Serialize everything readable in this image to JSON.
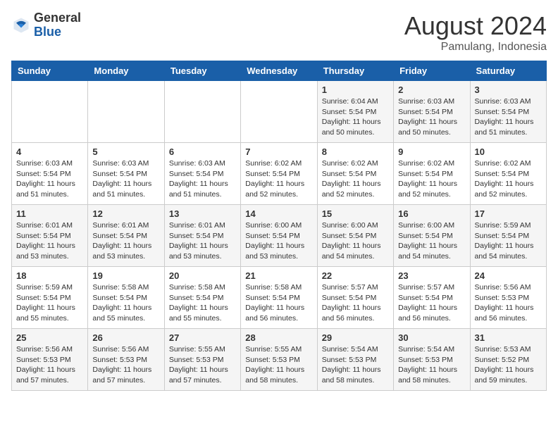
{
  "header": {
    "logo_general": "General",
    "logo_blue": "Blue",
    "month_year": "August 2024",
    "location": "Pamulang, Indonesia"
  },
  "weekdays": [
    "Sunday",
    "Monday",
    "Tuesday",
    "Wednesday",
    "Thursday",
    "Friday",
    "Saturday"
  ],
  "weeks": [
    [
      {
        "day": "",
        "info": ""
      },
      {
        "day": "",
        "info": ""
      },
      {
        "day": "",
        "info": ""
      },
      {
        "day": "",
        "info": ""
      },
      {
        "day": "1",
        "info": "Sunrise: 6:04 AM\nSunset: 5:54 PM\nDaylight: 11 hours\nand 50 minutes."
      },
      {
        "day": "2",
        "info": "Sunrise: 6:03 AM\nSunset: 5:54 PM\nDaylight: 11 hours\nand 50 minutes."
      },
      {
        "day": "3",
        "info": "Sunrise: 6:03 AM\nSunset: 5:54 PM\nDaylight: 11 hours\nand 51 minutes."
      }
    ],
    [
      {
        "day": "4",
        "info": "Sunrise: 6:03 AM\nSunset: 5:54 PM\nDaylight: 11 hours\nand 51 minutes."
      },
      {
        "day": "5",
        "info": "Sunrise: 6:03 AM\nSunset: 5:54 PM\nDaylight: 11 hours\nand 51 minutes."
      },
      {
        "day": "6",
        "info": "Sunrise: 6:03 AM\nSunset: 5:54 PM\nDaylight: 11 hours\nand 51 minutes."
      },
      {
        "day": "7",
        "info": "Sunrise: 6:02 AM\nSunset: 5:54 PM\nDaylight: 11 hours\nand 52 minutes."
      },
      {
        "day": "8",
        "info": "Sunrise: 6:02 AM\nSunset: 5:54 PM\nDaylight: 11 hours\nand 52 minutes."
      },
      {
        "day": "9",
        "info": "Sunrise: 6:02 AM\nSunset: 5:54 PM\nDaylight: 11 hours\nand 52 minutes."
      },
      {
        "day": "10",
        "info": "Sunrise: 6:02 AM\nSunset: 5:54 PM\nDaylight: 11 hours\nand 52 minutes."
      }
    ],
    [
      {
        "day": "11",
        "info": "Sunrise: 6:01 AM\nSunset: 5:54 PM\nDaylight: 11 hours\nand 53 minutes."
      },
      {
        "day": "12",
        "info": "Sunrise: 6:01 AM\nSunset: 5:54 PM\nDaylight: 11 hours\nand 53 minutes."
      },
      {
        "day": "13",
        "info": "Sunrise: 6:01 AM\nSunset: 5:54 PM\nDaylight: 11 hours\nand 53 minutes."
      },
      {
        "day": "14",
        "info": "Sunrise: 6:00 AM\nSunset: 5:54 PM\nDaylight: 11 hours\nand 53 minutes."
      },
      {
        "day": "15",
        "info": "Sunrise: 6:00 AM\nSunset: 5:54 PM\nDaylight: 11 hours\nand 54 minutes."
      },
      {
        "day": "16",
        "info": "Sunrise: 6:00 AM\nSunset: 5:54 PM\nDaylight: 11 hours\nand 54 minutes."
      },
      {
        "day": "17",
        "info": "Sunrise: 5:59 AM\nSunset: 5:54 PM\nDaylight: 11 hours\nand 54 minutes."
      }
    ],
    [
      {
        "day": "18",
        "info": "Sunrise: 5:59 AM\nSunset: 5:54 PM\nDaylight: 11 hours\nand 55 minutes."
      },
      {
        "day": "19",
        "info": "Sunrise: 5:58 AM\nSunset: 5:54 PM\nDaylight: 11 hours\nand 55 minutes."
      },
      {
        "day": "20",
        "info": "Sunrise: 5:58 AM\nSunset: 5:54 PM\nDaylight: 11 hours\nand 55 minutes."
      },
      {
        "day": "21",
        "info": "Sunrise: 5:58 AM\nSunset: 5:54 PM\nDaylight: 11 hours\nand 56 minutes."
      },
      {
        "day": "22",
        "info": "Sunrise: 5:57 AM\nSunset: 5:54 PM\nDaylight: 11 hours\nand 56 minutes."
      },
      {
        "day": "23",
        "info": "Sunrise: 5:57 AM\nSunset: 5:54 PM\nDaylight: 11 hours\nand 56 minutes."
      },
      {
        "day": "24",
        "info": "Sunrise: 5:56 AM\nSunset: 5:53 PM\nDaylight: 11 hours\nand 56 minutes."
      }
    ],
    [
      {
        "day": "25",
        "info": "Sunrise: 5:56 AM\nSunset: 5:53 PM\nDaylight: 11 hours\nand 57 minutes."
      },
      {
        "day": "26",
        "info": "Sunrise: 5:56 AM\nSunset: 5:53 PM\nDaylight: 11 hours\nand 57 minutes."
      },
      {
        "day": "27",
        "info": "Sunrise: 5:55 AM\nSunset: 5:53 PM\nDaylight: 11 hours\nand 57 minutes."
      },
      {
        "day": "28",
        "info": "Sunrise: 5:55 AM\nSunset: 5:53 PM\nDaylight: 11 hours\nand 58 minutes."
      },
      {
        "day": "29",
        "info": "Sunrise: 5:54 AM\nSunset: 5:53 PM\nDaylight: 11 hours\nand 58 minutes."
      },
      {
        "day": "30",
        "info": "Sunrise: 5:54 AM\nSunset: 5:53 PM\nDaylight: 11 hours\nand 58 minutes."
      },
      {
        "day": "31",
        "info": "Sunrise: 5:53 AM\nSunset: 5:52 PM\nDaylight: 11 hours\nand 59 minutes."
      }
    ]
  ]
}
